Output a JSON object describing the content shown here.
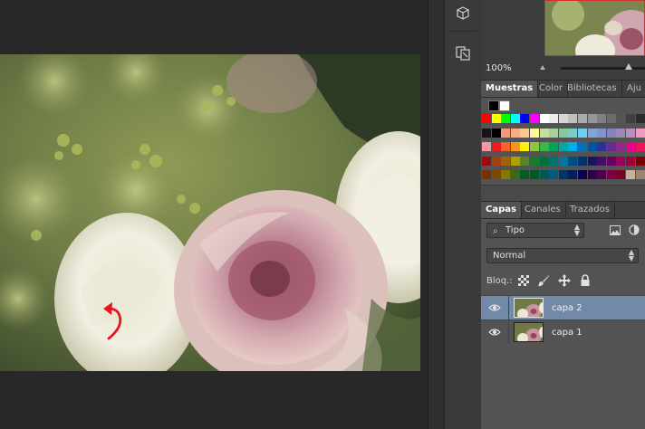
{
  "navigator": {
    "zoom": "100%"
  },
  "swatches_panel": {
    "tabs": [
      {
        "label": "Muestras",
        "active": true
      },
      {
        "label": "Color",
        "active": false
      },
      {
        "label": "Bibliotecas",
        "active": false
      },
      {
        "label": "Aju",
        "active": false
      }
    ],
    "colors": [
      [
        "#ff0000",
        "#ffff00",
        "#00ff00",
        "#00ffff",
        "#0000ff",
        "#ff00ff",
        "#ffffff",
        "#ebebeb",
        "#d6d6d6",
        "#c0c0c0",
        "#ababab",
        "#959595",
        "#808080",
        "#6b6b6b",
        "#555555",
        "#404040",
        "#2b2b2b"
      ],
      [
        "#151515",
        "#000000",
        "#f7977a",
        "#f9ad81",
        "#fdc68a",
        "#fff79a",
        "#c4df9b",
        "#a2d39c",
        "#82ca9d",
        "#7bcdc8",
        "#6ecff6",
        "#7ea7d8",
        "#8493ca",
        "#8882be",
        "#a187be",
        "#bc8dbf",
        "#f49ac2"
      ],
      [
        "#f6989d",
        "#ed1c24",
        "#f26522",
        "#f7941d",
        "#fff200",
        "#8dc73f",
        "#39b54a",
        "#00a651",
        "#00a99d",
        "#00aeef",
        "#0072bc",
        "#0054a6",
        "#2e3192",
        "#662d91",
        "#92278f",
        "#ec008c",
        "#ed145b"
      ],
      [
        "#9e0b0f",
        "#a0410d",
        "#a36209",
        "#aba000",
        "#598527",
        "#1a7b30",
        "#007236",
        "#00746b",
        "#0076a3",
        "#004b80",
        "#003471",
        "#1b1464",
        "#440e62",
        "#630460",
        "#9e005d",
        "#9e0039",
        "#790000"
      ],
      [
        "#7b2e00",
        "#7d4900",
        "#827b00",
        "#406618",
        "#005e20",
        "#005826",
        "#005952",
        "#005b7f",
        "#003663",
        "#002157",
        "#0d004c",
        "#32004b",
        "#4b0049",
        "#7b0046",
        "#7a0026",
        "#c7b299",
        "#998675"
      ]
    ]
  },
  "layers_panel": {
    "tabs": [
      {
        "label": "Capas",
        "active": true
      },
      {
        "label": "Canales",
        "active": false
      },
      {
        "label": "Trazados",
        "active": false
      }
    ],
    "filter_kind": "Tipo",
    "blend_mode": "Normal",
    "lock_label": "Bloq.:",
    "layers": [
      {
        "name": "capa 2",
        "visible": true,
        "selected": true
      },
      {
        "name": "capa 1",
        "visible": true,
        "selected": false
      }
    ]
  },
  "colors": {
    "panel_bg": "#535353",
    "selected_layer": "#7289a8",
    "annotation_arrow": "#e8141b",
    "canvas_bg": "#282828"
  }
}
